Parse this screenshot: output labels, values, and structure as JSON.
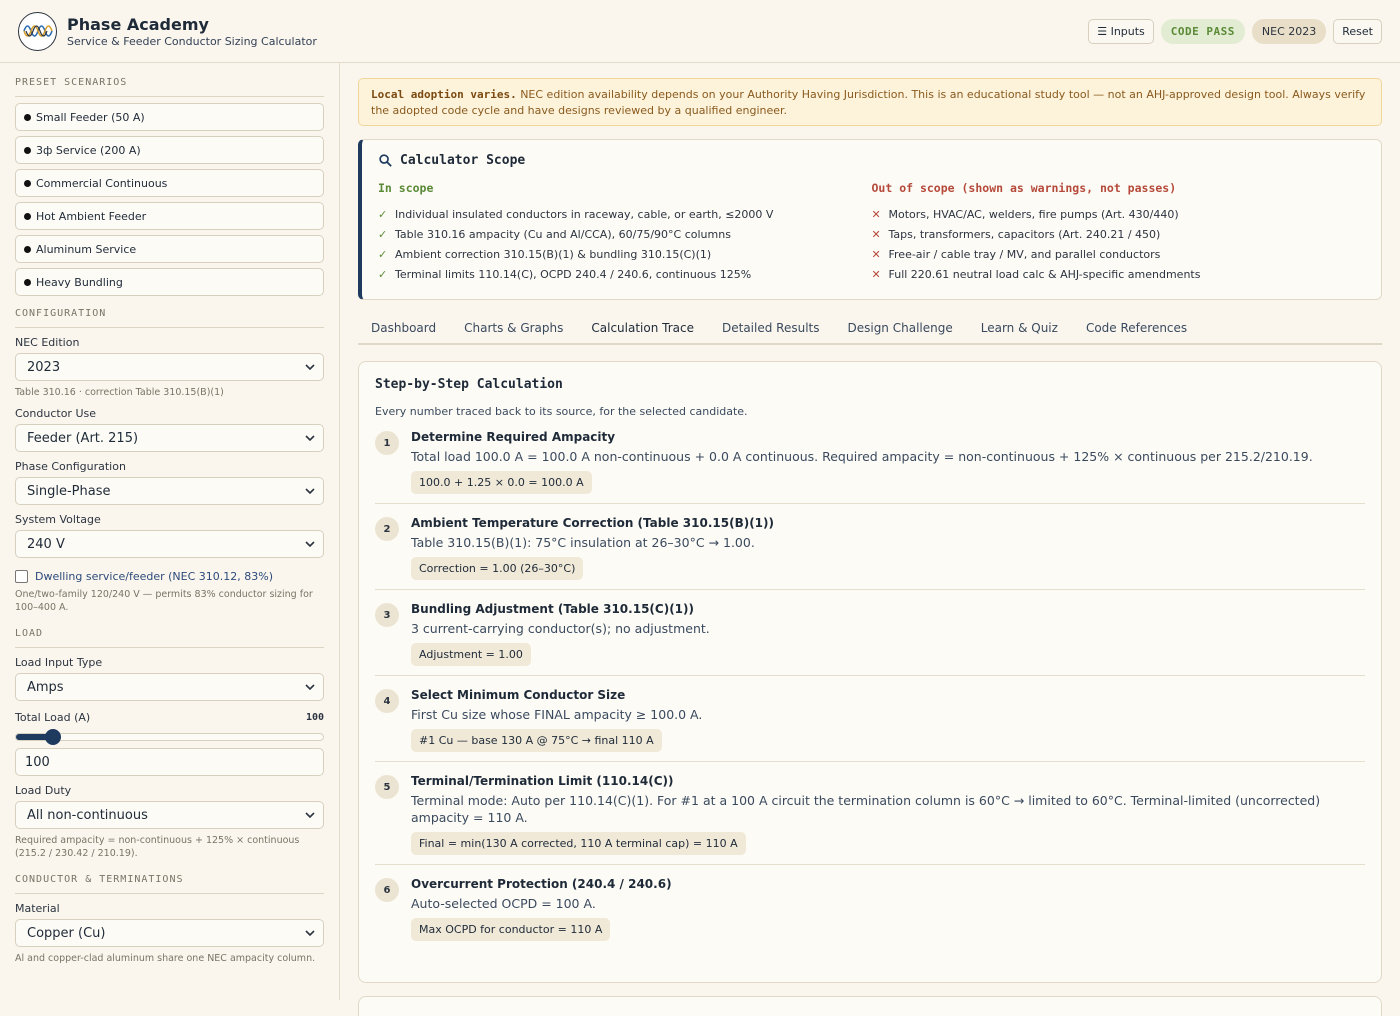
{
  "header": {
    "title": "Phase Academy",
    "subtitle": "Service & Feeder Conductor Sizing Calculator",
    "inputs_label": "☰ Inputs",
    "pass_label": "CODE PASS",
    "nec_label": "NEC 2023",
    "reset_label": "Reset"
  },
  "sidebar": {
    "presets_title": "PRESET SCENARIOS",
    "presets": [
      "Small Feeder (50 A)",
      "3ф Service (200 A)",
      "Commercial Continuous",
      "Hot Ambient Feeder",
      "Aluminum Service",
      "Heavy Bundling"
    ],
    "config_title": "CONFIGURATION",
    "nec_edition_label": "NEC Edition",
    "nec_edition_value": "2023",
    "nec_edition_hint": "Table 310.16 · correction Table 310.15(B)(1)",
    "conductor_use_label": "Conductor Use",
    "conductor_use_value": "Feeder (Art. 215)",
    "phase_label": "Phase Configuration",
    "phase_value": "Single-Phase",
    "voltage_label": "System Voltage",
    "voltage_value": "240 V",
    "dwelling_label": "Dwelling service/feeder (NEC 310.12, 83%)",
    "dwelling_hint": "One/two-family 120/240 V — permits 83% conductor sizing for 100–400 A.",
    "load_title": "LOAD",
    "load_type_label": "Load Input Type",
    "load_type_value": "Amps",
    "total_load_label": "Total Load (A)",
    "total_load_value": "100",
    "total_load_fraction": 0.12,
    "load_duty_label": "Load Duty",
    "load_duty_value": "All non-continuous",
    "load_duty_hint": "Required ampacity = non-continuous + 125% × continuous (215.2 / 230.42 / 210.19).",
    "conductor_title": "CONDUCTOR & TERMINATIONS",
    "material_label": "Material",
    "material_value": "Copper (Cu)",
    "material_hint": "Al and copper-clad aluminum share one NEC ampacity column."
  },
  "banner": {
    "bold": "Local adoption varies.",
    "text": " NEC edition availability depends on your Authority Having Jurisdiction. This is an educational study tool — not an AHJ-approved design tool. Always verify the adopted code cycle and have designs reviewed by a qualified engineer."
  },
  "scope": {
    "title": "Calculator Scope",
    "in_title": "In scope",
    "in_items": [
      "Individual insulated conductors in raceway, cable, or earth, ≤2000 V",
      "Table 310.16 ampacity (Cu and Al/CCA), 60/75/90°C columns",
      "Ambient correction 310.15(B)(1) & bundling 310.15(C)(1)",
      "Terminal limits 110.14(C), OCPD 240.4 / 240.6, continuous 125%"
    ],
    "out_title": "Out of scope (shown as warnings, not passes)",
    "out_items": [
      "Motors, HVAC/AC, welders, fire pumps (Art. 430/440)",
      "Taps, transformers, capacitors (Art. 240.21 / 450)",
      "Free-air / cable tray / MV, and parallel conductors",
      "Full 220.61 neutral load calc & AHJ-specific amendments"
    ]
  },
  "tabs": [
    "Dashboard",
    "Charts & Graphs",
    "Calculation Trace",
    "Detailed Results",
    "Design Challenge",
    "Learn & Quiz",
    "Code References"
  ],
  "trace": {
    "title": "Step-by-Step Calculation",
    "subtitle": "Every number traced back to its source, for the selected candidate.",
    "steps": [
      {
        "num": "1",
        "title": "Determine Required Ampacity",
        "desc": "Total load 100.0 A = 100.0 A non-continuous + 0.0 A continuous. Required ampacity = non-continuous + 125% × continuous per 215.2/210.19.",
        "formula": "100.0 + 1.25 × 0.0 = 100.0 A"
      },
      {
        "num": "2",
        "title": "Ambient Temperature Correction (Table 310.15(B)(1))",
        "desc": "Table 310.15(B)(1): 75°C insulation at 26–30°C → 1.00.",
        "formula": "Correction = 1.00 (26–30°C)"
      },
      {
        "num": "3",
        "title": "Bundling Adjustment (Table 310.15(C)(1))",
        "desc": "3 current-carrying conductor(s); no adjustment.",
        "formula": "Adjustment = 1.00"
      },
      {
        "num": "4",
        "title": "Select Minimum Conductor Size",
        "desc": "First Cu size whose FINAL ampacity ≥ 100.0 A.",
        "formula": "#1 Cu — base 130 A @ 75°C → final 110 A"
      },
      {
        "num": "5",
        "title": "Terminal/Termination Limit (110.14(C))",
        "desc": "Terminal mode: Auto per 110.14(C)(1). For #1 at a 100 A circuit the termination column is 60°C → limited to 60°C. Terminal-limited (uncorrected) ampacity = 110 A.",
        "formula": "Final = min(130 A corrected, 110 A terminal cap) = 110 A"
      },
      {
        "num": "6",
        "title": "Overcurrent Protection (240.4 / 240.6)",
        "desc": "Auto-selected OCPD = 100 A.",
        "formula": "Max OCPD for conductor = 110 A"
      }
    ]
  }
}
